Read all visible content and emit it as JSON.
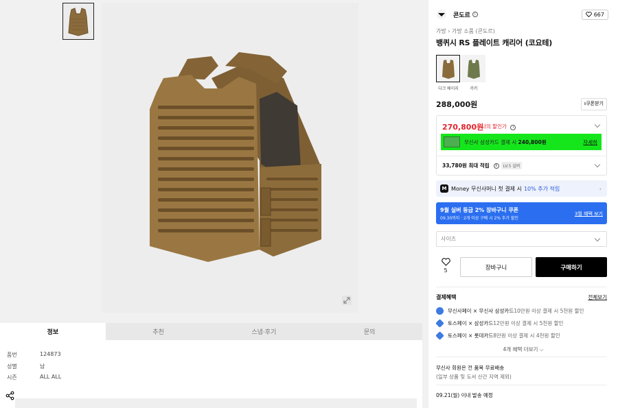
{
  "left": {
    "tabs": [
      "정보",
      "추천",
      "스냅·후기",
      "문의"
    ],
    "info": [
      {
        "key": "품번",
        "value": "124873"
      },
      {
        "key": "성별",
        "value": "남"
      },
      {
        "key": "시즌",
        "value": "ALL ALL"
      }
    ]
  },
  "right": {
    "brand": "콘도르",
    "like_count": "667",
    "breadcrumb": "가방 › 가방 소품 (콘도르)",
    "title": "뱅퀴시 RS 플레이트 캐리어 (코요테)",
    "swatches": [
      {
        "label": "다크 베이지",
        "color": "#8b6b3c"
      },
      {
        "label": "카키",
        "color": "#6e7a4c"
      }
    ],
    "price": "288,000원",
    "coupon_label": "쿠폰받기",
    "sale_price": "270,800원",
    "sale_tag": "나의 할인가",
    "card_promo_prefix": "무신사 삼성카드 결제 시",
    "card_promo_price": "240,800원",
    "card_link": "자세히",
    "points": "33,780원 최대 적립",
    "level": "LV.5 실버",
    "money_prefix": "Money",
    "money_text": "무신사머니 첫 결제 시",
    "money_blue": "10% 추가 적립",
    "banner_title": "9월 실버 등급 2% 장바구니 쿠폰",
    "banner_sub": "09.30까지 · 2개 이상 구매 시 2% 추가 할인",
    "banner_link": "3월 혜택 보기",
    "size_placeholder": "사이즈",
    "wish_count": "5",
    "cart_label": "장바구니",
    "buy_label": "구매하기",
    "pay_title": "결제혜택",
    "pay_all": "전체보기",
    "pay_rows": [
      {
        "bold": "무신사페이 × 무신사 삼성카드",
        "rest": " 10만원 이상 결제 시 5천원 할인"
      },
      {
        "bold": "토스페이 × 삼성카드",
        "rest": " 12만원 이상 결제 시 5천원 할인"
      },
      {
        "bold": "토스페이 × 롯데카드",
        "rest": " 8만원 이상 결제 시 4천원 할인"
      }
    ],
    "more": "4개 혜택 더보기",
    "ship1": "무신사 회원은 전 품목 무료배송",
    "ship2": "(일부 상품 및 도서 산간 지역 제외)",
    "ship3": "09.21(월) 이내 발송 예정",
    "colors": {
      "accent_red": "#e2242b",
      "promo_green": "#15e61c",
      "banner_blue": "#2b6ff0"
    }
  }
}
